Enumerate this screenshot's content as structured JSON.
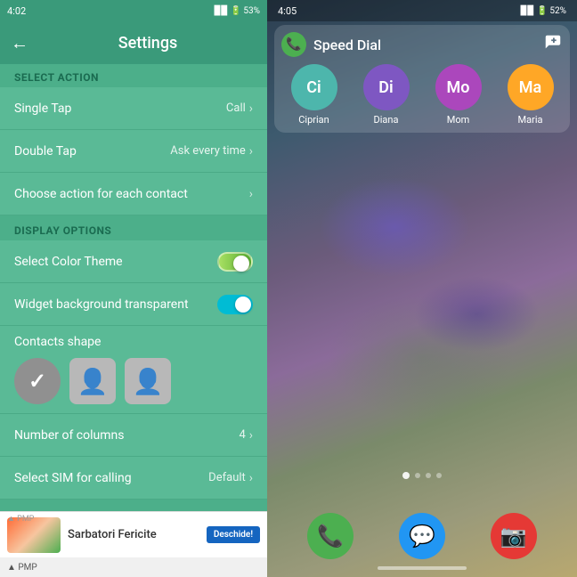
{
  "left": {
    "statusBar": {
      "time": "4:02",
      "icons": "📶 🔋53%"
    },
    "header": {
      "title": "Settings",
      "backLabel": "←"
    },
    "selectAction": {
      "sectionHeader": "SELECT ACTION",
      "items": [
        {
          "label": "Single Tap",
          "value": "Call",
          "hasChevron": true
        },
        {
          "label": "Double Tap",
          "value": "Ask every time",
          "hasChevron": true
        },
        {
          "label": "Choose action for each contact",
          "value": "",
          "hasChevron": true
        }
      ]
    },
    "displayOptions": {
      "sectionHeader": "DISPLAY OPTIONS",
      "items": [
        {
          "label": "Select Color Theme",
          "hasToggle": true,
          "toggleType": "color"
        },
        {
          "label": "Widget background transparent",
          "hasToggle": true,
          "toggleType": "cyan"
        },
        {
          "label": "Contacts shape",
          "isShapeSection": true
        }
      ]
    },
    "numberColumns": {
      "label": "Number of columns",
      "value": "4",
      "hasChevron": true
    },
    "selectSIM": {
      "label": "Select SIM for calling",
      "value": "Default",
      "hasChevron": true
    },
    "ad": {
      "label": "▲ PMP",
      "text": "Sarbatori Fericite",
      "buttonLabel": "Deschide!"
    }
  },
  "right": {
    "statusBar": {
      "time": "4:05",
      "icons": "📶 🔋52%"
    },
    "widget": {
      "title": "Speed Dial",
      "addIcon": "person+"
    },
    "contacts": [
      {
        "initials": "Ci",
        "name": "Ciprian",
        "color": "#4db6ac"
      },
      {
        "initials": "Di",
        "name": "Diana",
        "color": "#7e57c2"
      },
      {
        "initials": "Mo",
        "name": "Mom",
        "color": "#ab47bc"
      },
      {
        "initials": "Ma",
        "name": "Maria",
        "color": "#ffa726"
      }
    ],
    "pageIndicators": [
      {
        "active": true
      },
      {
        "active": false
      },
      {
        "active": false
      },
      {
        "active": false
      }
    ],
    "dockApps": [
      {
        "name": "Phone",
        "icon": "📞",
        "color": "#4caf50"
      },
      {
        "name": "Messages",
        "icon": "💬",
        "color": "#2196f3"
      },
      {
        "name": "Camera",
        "icon": "📷",
        "color": "#e53935"
      }
    ]
  }
}
